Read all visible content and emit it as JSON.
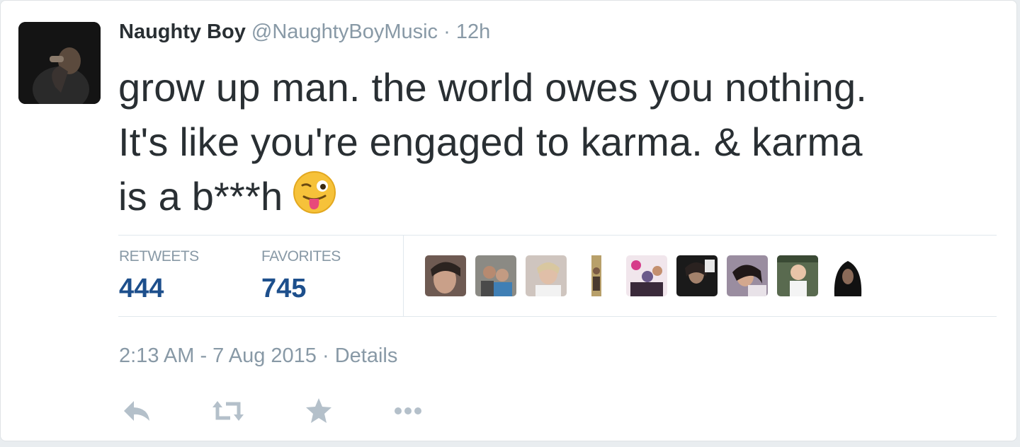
{
  "tweet": {
    "author_name": "Naughty Boy",
    "author_handle": "@NaughtyBoyMusic",
    "separator": "·",
    "relative_time": "12h",
    "text_line1": "grow up man. the world owes you nothing.",
    "text_line2": "It's like you're engaged to karma. & karma",
    "text_line3": "is a b***h"
  },
  "stats": {
    "retweets_label": "RETWEETS",
    "retweets_count": "444",
    "favorites_label": "FAVORITES",
    "favorites_count": "745"
  },
  "footer": {
    "timestamp": "2:13 AM - 7 Aug 2015",
    "separator": "·",
    "details_label": "Details"
  },
  "icons": {
    "emoji": "winking-face-with-tongue-icon",
    "reply": "reply-icon",
    "retweet": "retweet-icon",
    "favorite": "star-icon",
    "more": "more-icon"
  },
  "colors": {
    "name": "#292f33",
    "muted": "#8899a6",
    "count": "#1d4f8c",
    "divider": "#e1e8ed"
  }
}
